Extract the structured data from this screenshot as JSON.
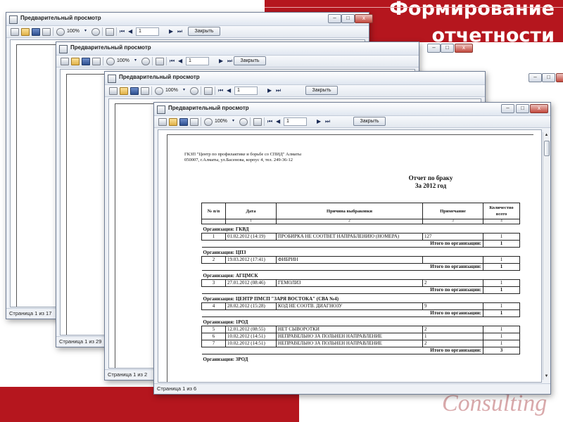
{
  "slide": {
    "title": "Формирование\nотчетности",
    "logo_text": "Consulting",
    "accent_color": "#b5161e"
  },
  "window": {
    "title": "Предварительный просмотр",
    "icon": "printer-icon",
    "controls": {
      "minimize": "–",
      "maximize": "□",
      "close": "x"
    },
    "toolbar": {
      "zoom_value": "100%",
      "page_value": "1",
      "close_label": "Закрыть",
      "icons": [
        "print-icon",
        "open-folder-icon",
        "save-icon",
        "export-icon",
        "zoom-in-icon",
        "zoom-out-icon",
        "edit-icon",
        "first-page-icon",
        "prev-page-icon",
        "next-page-icon",
        "last-page-icon"
      ],
      "nav_glyphs": {
        "first": "⏮",
        "prev": "◀",
        "next": "▶",
        "last": "⏭"
      }
    }
  },
  "windows": [
    {
      "status": "Страница 1 из 17"
    },
    {
      "status": "Страница 1 из 29"
    },
    {
      "status": "Страница 1 из 2"
    },
    {
      "status": "Страница 1 из 6"
    }
  ],
  "report": {
    "org_header": "ГКЗП \"Центр по профилактике и борьбе со СПИД\" Алматы\n050007, г.Алматы, ул.Басенова, корпус 4, тел. 249-36-12",
    "title_line1": "Отчет по браку",
    "title_line2": "За 2012 год",
    "columns": [
      "№ п/п",
      "Дата",
      "Причина выбраковки",
      "Примечание",
      "Количество всего"
    ],
    "column_numbers": [
      "1",
      "2",
      "3",
      "4"
    ],
    "total_label": "Итого по организации:",
    "groups": [
      {
        "org": "Организация: ГКВД",
        "rows": [
          [
            "1",
            "01.02.2012 (14:19)",
            "ПРОБИРКА НЕ СООТВЕТ  НАПРАБЛЕНИЮ (НОМЕРА)",
            "127",
            "1"
          ]
        ],
        "total": "1"
      },
      {
        "org": "Организация: ЦПЗ",
        "rows": [
          [
            "2",
            "19.03.2012 (17:41)",
            "ФИБРИН",
            "",
            "1"
          ]
        ],
        "total": "1"
      },
      {
        "org": "Организация: АГЦМСК",
        "rows": [
          [
            "3",
            "27.01.2012 (08:46)",
            "ГЕМОЛИЗ",
            "2",
            "1"
          ]
        ],
        "total": "1"
      },
      {
        "org": "Организация: ЦЕНТР ПМСП \"ЗАРЯ ВОСТОКА\" (СВА №4)",
        "rows": [
          [
            "4",
            "28.02.2012 (15:28)",
            "КОД НЕ СООТВ. ДИАГНОЗУ",
            "9",
            "1"
          ]
        ],
        "total": "1"
      },
      {
        "org": "Организация: 1РОД",
        "rows": [
          [
            "5",
            "12.01.2012 (08:55)",
            "НЕТ СЫВОРОТКИ",
            "2",
            "1"
          ],
          [
            "6",
            "10.02.2012 (14:51)",
            "НЕПРАВЕЛЬНО  ЗА ПОЛЬНЕН  НАПРАВЛЕНИЕ",
            "1",
            "1"
          ],
          [
            "7",
            "10.02.2012 (14:51)",
            "НЕПРАВЕЛЬНО  ЗА ПОЛЬНЕН  НАПРАВЛЕНИЕ",
            "2",
            "1"
          ]
        ],
        "total": "3"
      }
    ],
    "next_org_partial": "Организация: 3РОД"
  }
}
